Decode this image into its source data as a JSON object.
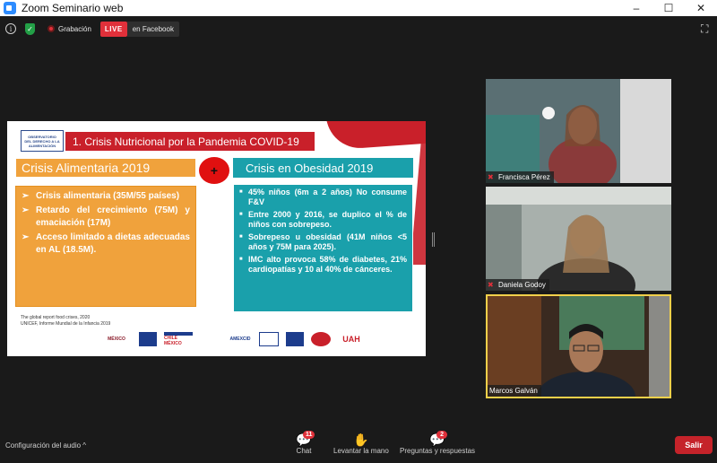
{
  "window": {
    "title": "Zoom Seminario web",
    "controls": [
      "–",
      "☐",
      "✕"
    ]
  },
  "topbar": {
    "recording_label": "Grabación",
    "live_badge": "LIVE",
    "live_destination": "en Facebook"
  },
  "slide": {
    "logo_lines": [
      "OBSERVATORIO",
      "DEL DERECHO A LA",
      "ALIMENTACIÓN"
    ],
    "title": "1. Crisis Nutricional por la Pandemia COVID-19",
    "food_crisis": {
      "title": "Crisis Alimentaria 2019",
      "items": [
        "Crisis alimentaria (35M/55 países)",
        "Retardo del crecimiento (75M) y emaciación (17M)",
        "Acceso limitado a dietas adecuadas en AL (18.5M)."
      ]
    },
    "plus_sign": "+",
    "obesity_crisis": {
      "title": "Crisis en Obesidad 2019",
      "items": [
        "45% niños (6m a 2 años) No consume F&V",
        "Entre 2000 y 2016, se duplico el % de niños con sobrepeso.",
        "Sobrepeso u obesidad (41M niños <5 años y 75M para 2025).",
        "IMC alto provoca 58% de diabetes, 21% cardiopatías y 10 al 40% de cánceres."
      ]
    },
    "sources": [
      "The global report food crises, 2020",
      "UNICEF, Informe Mundial de la Infancia 2019"
    ],
    "logos": [
      "MÉXICO",
      "CHILE",
      "CHILE MÉXICO",
      "AMEXCID",
      "",
      "",
      "",
      "UAH"
    ]
  },
  "participants": [
    {
      "name": "Francisca Pérez",
      "muted": true
    },
    {
      "name": "Daniela Godoy",
      "muted": true
    },
    {
      "name": "Marcos Galván",
      "muted": false,
      "active_speaker": true
    }
  ],
  "bottombar": {
    "audio_config": "Configuración del audio",
    "chat": {
      "label": "Chat",
      "badge": "11"
    },
    "raise_hand": {
      "label": "Levantar la mano"
    },
    "qa": {
      "label": "Preguntas y respuestas",
      "badge": "2"
    },
    "leave": "Salir"
  },
  "colors": {
    "live": "#e0303a",
    "food": "#f0a23c",
    "obesity": "#1aa0ab",
    "slide_red": "#c9202a",
    "active_speaker": "#f2d04a"
  }
}
